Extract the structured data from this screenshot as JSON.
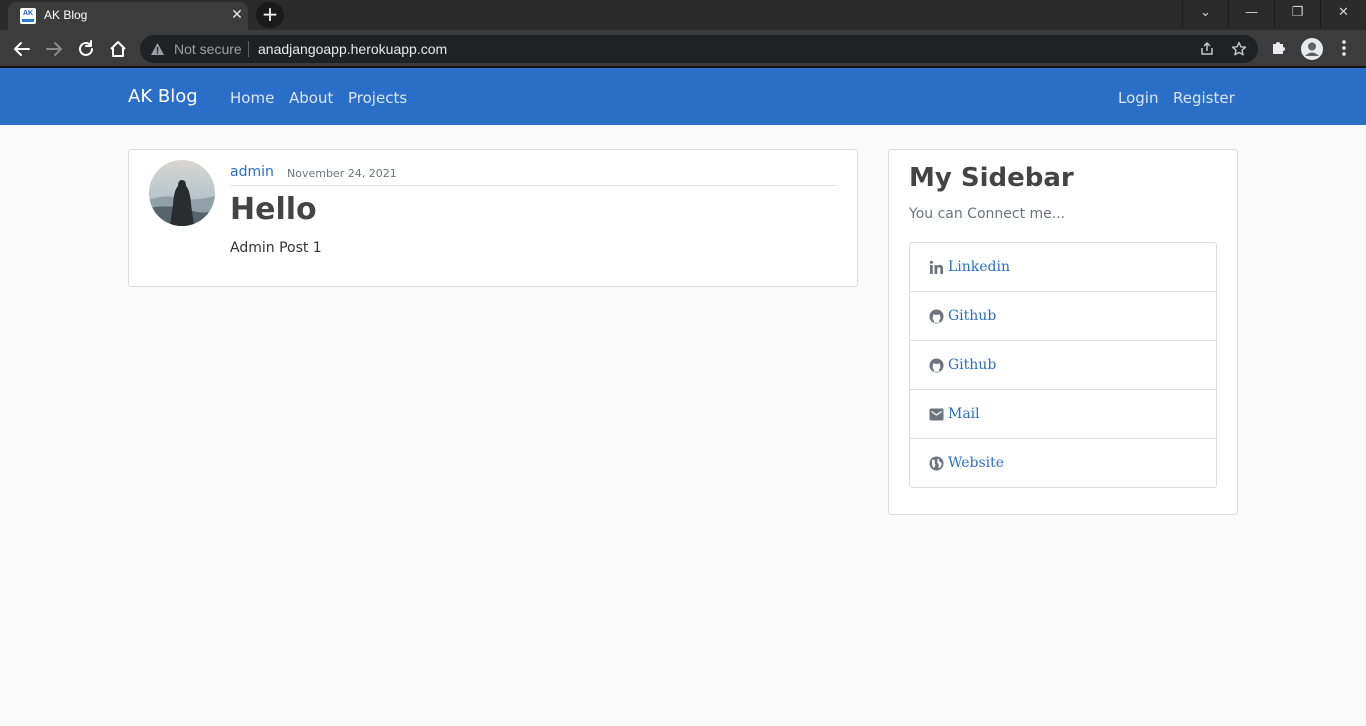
{
  "browser": {
    "tab": {
      "favicon_text": "AK",
      "title": "AK Blog",
      "close_glyph": "✕"
    },
    "new_tab_glyph": "+",
    "window_controls": {
      "tabsearch_glyph": "⌄",
      "minimize_glyph": "—",
      "restore_glyph": "❐",
      "close_glyph": "✕"
    },
    "security_label": "Not secure",
    "url": "anadjangoapp.herokuapp.com"
  },
  "site": {
    "brand": "AK Blog",
    "nav": {
      "home": "Home",
      "about": "About",
      "projects": "Projects"
    },
    "auth": {
      "login": "Login",
      "register": "Register"
    },
    "colors": {
      "navbar": "#2a6ec7",
      "link": "#2a6ec7",
      "background": "#fafafa"
    }
  },
  "post": {
    "author": "admin",
    "date": "November 24, 2021",
    "title": "Hello",
    "content": "Admin Post 1"
  },
  "sidebar": {
    "title": "My Sidebar",
    "subtitle": "You can Connect me...",
    "links": [
      {
        "icon": "linkedin-icon",
        "label": "Linkedin"
      },
      {
        "icon": "github-icon",
        "label": "Github"
      },
      {
        "icon": "github-icon",
        "label": "Github"
      },
      {
        "icon": "envelope-icon",
        "label": "Mail"
      },
      {
        "icon": "globe-icon",
        "label": "Website"
      }
    ]
  }
}
